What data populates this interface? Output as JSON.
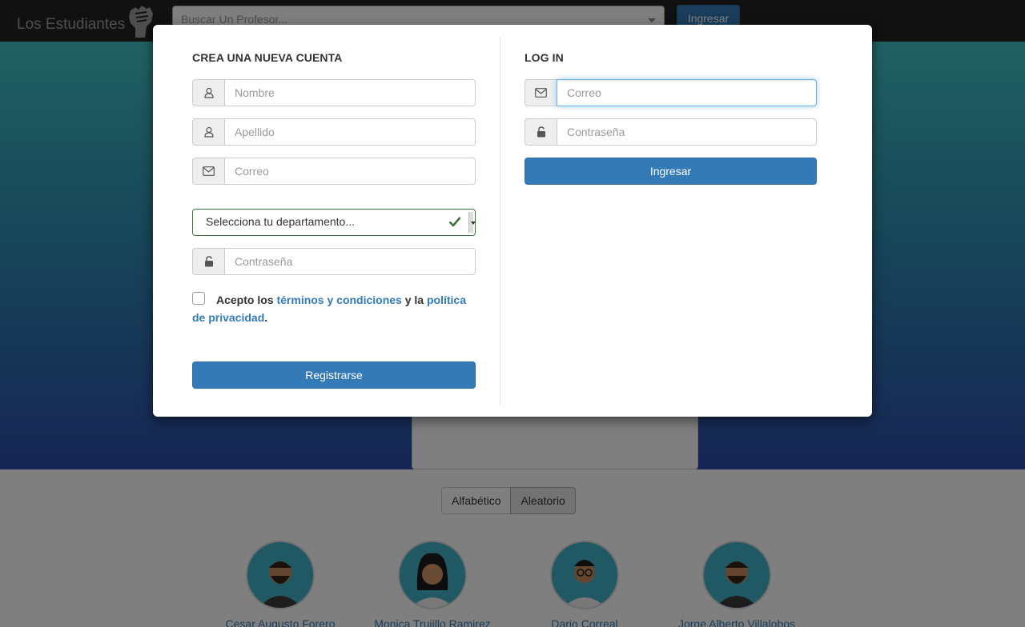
{
  "navbar": {
    "brand": "Los Estudiantes",
    "search_placeholder": "Buscar Un Profesor...",
    "login_label": "Ingresar"
  },
  "sort": {
    "alphabetic": "Alfabético",
    "random": "Aleatorio"
  },
  "professors": [
    {
      "name": "Cesar Augusto Forero"
    },
    {
      "name": "Monica Trujillo Ramirez"
    },
    {
      "name": "Dario Correal"
    },
    {
      "name": "Jorge Alberto Villalobos"
    }
  ],
  "modal": {
    "register": {
      "title": "CREA UNA NUEVA CUENTA",
      "nombre_placeholder": "Nombre",
      "apellido_placeholder": "Apellido",
      "correo_placeholder": "Correo",
      "department_select": "Selecciona tu departamento...",
      "password_placeholder": "Contraseña",
      "terms": {
        "prefix": "Acepto los",
        "terms_link": "términos y condiciones",
        "middle": "y la",
        "privacy_link_1": "política",
        "privacy_link_2": "de privacidad",
        "suffix": "."
      },
      "submit_label": "Registrarse"
    },
    "login": {
      "title": "LOG IN",
      "correo_placeholder": "Correo",
      "password_placeholder": "Contraseña",
      "submit_label": "Ingresar"
    }
  },
  "colors": {
    "primary": "#337ab7",
    "valid": "#3c763d",
    "focus": "#66afe9"
  }
}
